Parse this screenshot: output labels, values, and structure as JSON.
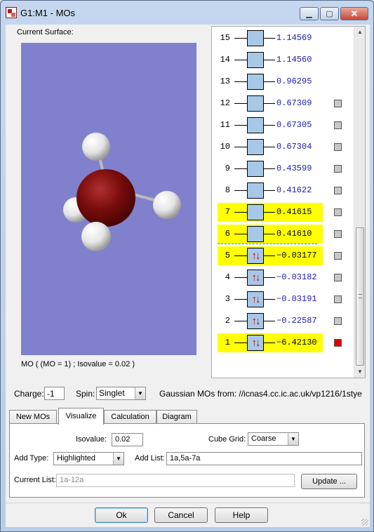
{
  "window": {
    "title": "G1:M1 - MOs",
    "close_glyph": "✕",
    "minimize_glyph": "▁",
    "maximize_glyph": "▢"
  },
  "left": {
    "surface_label": "Current Surface:",
    "mo_caption": "MO ( (MO = 1) ; Isovalue = 0.02 )"
  },
  "mo_list": {
    "electron_pair_glyph": "↑↓",
    "rows": [
      {
        "n": "15",
        "energy": "1.14569",
        "occupied": false,
        "highlighted": false,
        "marker": "none"
      },
      {
        "n": "14",
        "energy": "1.14560",
        "occupied": false,
        "highlighted": false,
        "marker": "none"
      },
      {
        "n": "13",
        "energy": "0.96295",
        "occupied": false,
        "highlighted": false,
        "marker": "none"
      },
      {
        "n": "12",
        "energy": "0.67309",
        "occupied": false,
        "highlighted": false,
        "marker": "grey"
      },
      {
        "n": "11",
        "energy": "0.67305",
        "occupied": false,
        "highlighted": false,
        "marker": "grey"
      },
      {
        "n": "10",
        "energy": "0.67304",
        "occupied": false,
        "highlighted": false,
        "marker": "grey"
      },
      {
        "n": "9",
        "energy": "0.43599",
        "occupied": false,
        "highlighted": false,
        "marker": "grey"
      },
      {
        "n": "8",
        "energy": "0.41622",
        "occupied": false,
        "highlighted": false,
        "marker": "grey"
      },
      {
        "n": "7",
        "energy": "0.41615",
        "occupied": false,
        "highlighted": true,
        "marker": "grey"
      },
      {
        "n": "6",
        "energy": "0.41610",
        "occupied": false,
        "highlighted": true,
        "marker": "grey"
      },
      {
        "n": "5",
        "energy": "-0.03177",
        "occupied": true,
        "highlighted": true,
        "marker": "grey"
      },
      {
        "n": "4",
        "energy": "-0.03182",
        "occupied": true,
        "highlighted": false,
        "marker": "grey"
      },
      {
        "n": "3",
        "energy": "-0.03191",
        "occupied": true,
        "highlighted": false,
        "marker": "grey"
      },
      {
        "n": "2",
        "energy": "-0.22587",
        "occupied": true,
        "highlighted": false,
        "marker": "grey"
      },
      {
        "n": "1",
        "energy": "-6.42130",
        "occupied": true,
        "highlighted": true,
        "marker": "red"
      }
    ]
  },
  "controls": {
    "charge_label": "Charge:",
    "charge_value": "-1",
    "spin_label": "Spin:",
    "spin_value": "Singlet",
    "source_text": "Gaussian MOs from:  //icnas4.cc.ic.ac.uk/vp1216/1stye"
  },
  "tabs": [
    "New MOs",
    "Visualize",
    "Calculation",
    "Diagram"
  ],
  "active_tab": "Visualize",
  "visualize": {
    "isovalue_label": "Isovalue:",
    "isovalue": "0.02",
    "cube_grid_label": "Cube Grid:",
    "cube_grid": "Coarse",
    "add_type_label": "Add Type:",
    "add_type": "Highlighted",
    "add_list_label": "Add List:",
    "add_list": "1a,5a-7a",
    "current_list_label": "Current List:",
    "current_list": "1a-12a",
    "update_label": "Update ..."
  },
  "buttons": {
    "ok": "Ok",
    "cancel": "Cancel",
    "help": "Help"
  },
  "colors": {
    "viewport_bg": "#8080cc",
    "orbital": "#8b1010",
    "highlight": "#ffff00",
    "energy_text": "#1a1ab0",
    "occupied_arrows": "#d00000",
    "selected_marker": "#e00000"
  }
}
